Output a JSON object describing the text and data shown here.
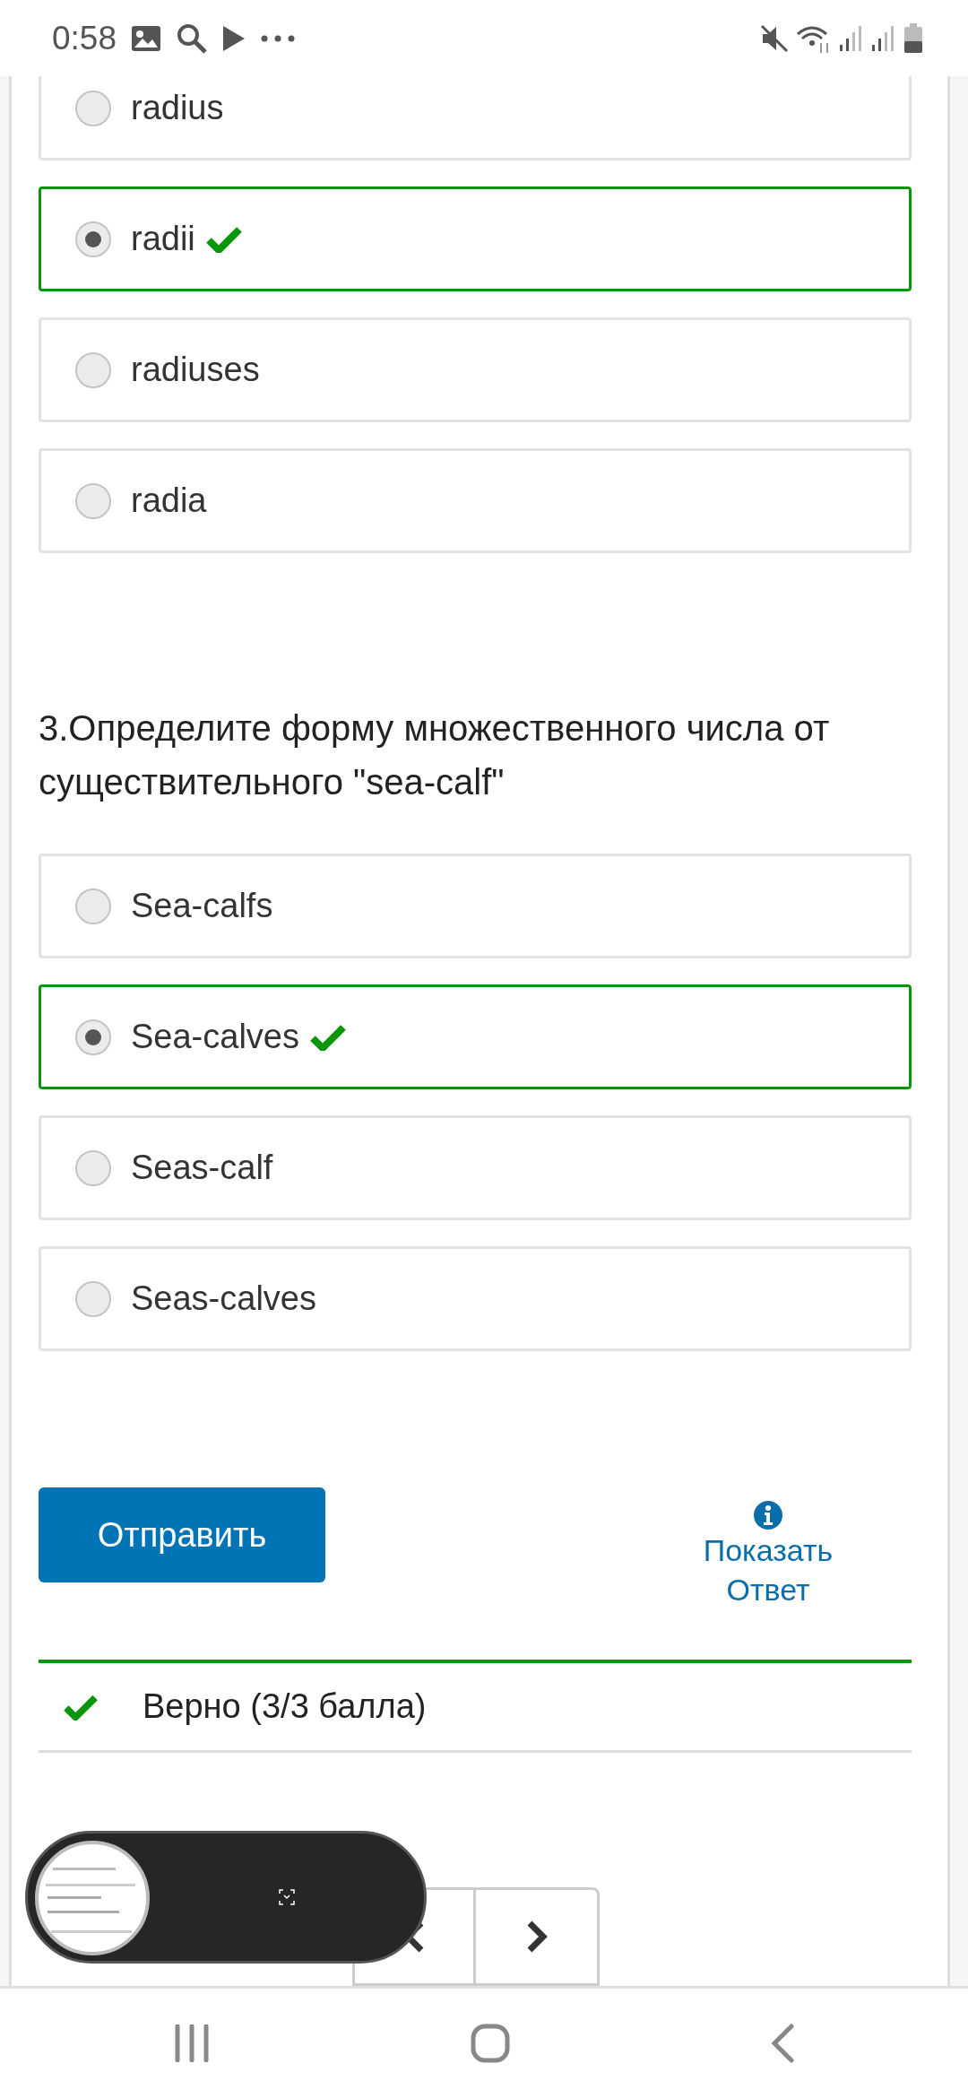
{
  "status_bar": {
    "time": "0:58"
  },
  "questions": [
    {
      "options": [
        {
          "label": "radius",
          "selected": false,
          "correct": false
        },
        {
          "label": "radii",
          "selected": true,
          "correct": true
        },
        {
          "label": "radiuses",
          "selected": false,
          "correct": false
        },
        {
          "label": "radia",
          "selected": false,
          "correct": false
        }
      ]
    },
    {
      "prompt": "3.Определите форму множественного числа от существительного \"sea-calf\"",
      "options": [
        {
          "label": "Sea-calfs",
          "selected": false,
          "correct": false
        },
        {
          "label": "Sea-calves",
          "selected": true,
          "correct": true
        },
        {
          "label": "Seas-calf",
          "selected": false,
          "correct": false
        },
        {
          "label": "Seas-calves",
          "selected": false,
          "correct": false
        }
      ]
    }
  ],
  "actions": {
    "submit": "Отправить",
    "show_answer": "Показать Ответ"
  },
  "result": {
    "text": "Верно (3/3 балла)",
    "correct": true
  }
}
